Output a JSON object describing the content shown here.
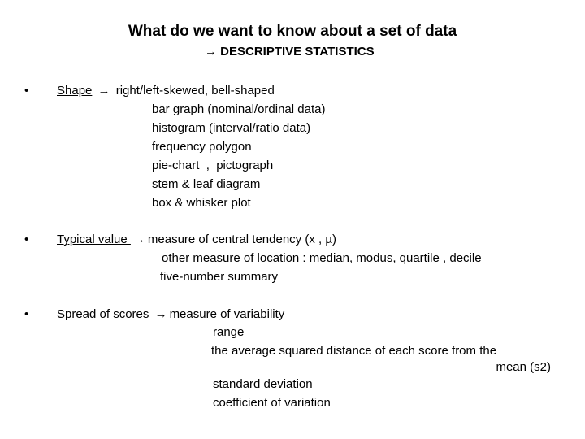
{
  "slide": {
    "title": "What do we want to know about a set of data",
    "subtitle_arrow": "→",
    "subtitle": "DESCRIPTIVE STATISTICS",
    "bullet_glyph": "•",
    "arrow_glyph": "→",
    "sections": [
      {
        "heading": "Shape",
        "lead": "right/left-skewed, bell-shaped",
        "items": [
          "bar graph (nominal/ordinal data)",
          "histogram (interval/ratio data)",
          "frequency polygon",
          "pie-chart  ,  pictograph",
          "stem & leaf diagram",
          "box & whisker plot"
        ]
      },
      {
        "heading": "Typical value ",
        "lead": "measure of central tendency (x , µ)",
        "items": [
          "other measure of location : median, modus, quartile , decile",
          "five-number summary"
        ]
      },
      {
        "heading": "Spread of scores ",
        "lead": "measure of variability",
        "items": [
          "range",
          "the average squared distance of each score from the",
          "mean (s2)",
          "standard deviation",
          "coefficient of variation"
        ]
      }
    ]
  }
}
